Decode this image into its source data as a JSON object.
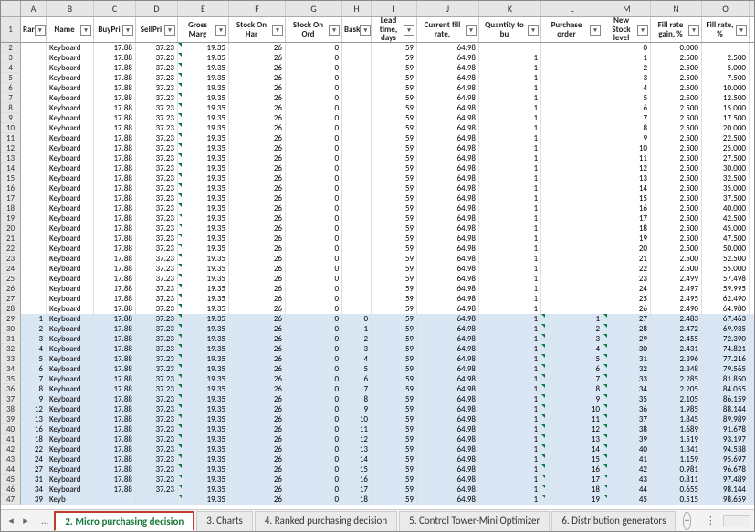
{
  "cols": [
    "A",
    "B",
    "C",
    "D",
    "E",
    "F",
    "G",
    "H",
    "I",
    "J",
    "K",
    "L",
    "M",
    "N",
    "O"
  ],
  "headers": [
    "Rar",
    "Name",
    "BuyPri",
    "SellPri",
    "Gross Marg",
    "Stock On Har",
    "Stock On Ord",
    "Bask",
    "Lead time, days",
    "Current fill rate,",
    "Quantity to bu",
    "Purchase order",
    "New Stock level",
    "Fill rate gain, %",
    "Fill rate, %"
  ],
  "widths": [
    "c-A",
    "c-B",
    "c-C",
    "c-D",
    "c-E",
    "c-F",
    "c-G",
    "c-H",
    "c-I",
    "c-J",
    "c-K",
    "c-L",
    "c-M",
    "c-N",
    "c-O"
  ],
  "align": [
    "ar",
    "al",
    "ar",
    "ar",
    "ar",
    "ar",
    "ar",
    "ar",
    "ar",
    "ar",
    "ar",
    "ar",
    "ar",
    "ar",
    "ar"
  ],
  "rows_top": [
    {
      "r": 2,
      "d": [
        "",
        "Keyboard",
        "17.88",
        "37.23",
        "19.35",
        "26",
        "0",
        "",
        "59",
        "64.98",
        "",
        "",
        "0",
        "0.000",
        ""
      ]
    },
    {
      "r": 3,
      "d": [
        "",
        "Keyboard",
        "17.88",
        "37.23",
        "19.35",
        "26",
        "0",
        "",
        "59",
        "64.98",
        "1",
        "",
        "1",
        "2.500",
        "2.500"
      ]
    },
    {
      "r": 4,
      "d": [
        "",
        "Keyboard",
        "17.88",
        "37.23",
        "19.35",
        "26",
        "0",
        "",
        "59",
        "64.98",
        "1",
        "",
        "2",
        "2.500",
        "5.000"
      ]
    },
    {
      "r": 5,
      "d": [
        "",
        "Keyboard",
        "17.88",
        "37.23",
        "19.35",
        "26",
        "0",
        "",
        "59",
        "64.98",
        "1",
        "",
        "3",
        "2.500",
        "7.500"
      ]
    },
    {
      "r": 6,
      "d": [
        "",
        "Keyboard",
        "17.88",
        "37.23",
        "19.35",
        "26",
        "0",
        "",
        "59",
        "64.98",
        "1",
        "",
        "4",
        "2.500",
        "10.000"
      ]
    },
    {
      "r": 7,
      "d": [
        "",
        "Keyboard",
        "17.88",
        "37.23",
        "19.35",
        "26",
        "0",
        "",
        "59",
        "64.98",
        "1",
        "",
        "5",
        "2.500",
        "12.500"
      ]
    },
    {
      "r": 8,
      "d": [
        "",
        "Keyboard",
        "17.88",
        "37.23",
        "19.35",
        "26",
        "0",
        "",
        "59",
        "64.98",
        "1",
        "",
        "6",
        "2.500",
        "15.000"
      ]
    },
    {
      "r": 9,
      "d": [
        "",
        "Keyboard",
        "17.88",
        "37.23",
        "19.35",
        "26",
        "0",
        "",
        "59",
        "64.98",
        "1",
        "",
        "7",
        "2.500",
        "17.500"
      ]
    },
    {
      "r": 10,
      "d": [
        "",
        "Keyboard",
        "17.88",
        "37.23",
        "19.35",
        "26",
        "0",
        "",
        "59",
        "64.98",
        "1",
        "",
        "8",
        "2.500",
        "20.000"
      ]
    },
    {
      "r": 11,
      "d": [
        "",
        "Keyboard",
        "17.88",
        "37.23",
        "19.35",
        "26",
        "0",
        "",
        "59",
        "64.98",
        "1",
        "",
        "9",
        "2.500",
        "22.500"
      ]
    },
    {
      "r": 12,
      "d": [
        "",
        "Keyboard",
        "17.88",
        "37.23",
        "19.35",
        "26",
        "0",
        "",
        "59",
        "64.98",
        "1",
        "",
        "10",
        "2.500",
        "25.000"
      ]
    },
    {
      "r": 13,
      "d": [
        "",
        "Keyboard",
        "17.88",
        "37.23",
        "19.35",
        "26",
        "0",
        "",
        "59",
        "64.98",
        "1",
        "",
        "11",
        "2.500",
        "27.500"
      ]
    },
    {
      "r": 14,
      "d": [
        "",
        "Keyboard",
        "17.88",
        "37.23",
        "19.35",
        "26",
        "0",
        "",
        "59",
        "64.98",
        "1",
        "",
        "12",
        "2.500",
        "30.000"
      ]
    },
    {
      "r": 15,
      "d": [
        "",
        "Keyboard",
        "17.88",
        "37.23",
        "19.35",
        "26",
        "0",
        "",
        "59",
        "64.98",
        "1",
        "",
        "13",
        "2.500",
        "32.500"
      ]
    },
    {
      "r": 16,
      "d": [
        "",
        "Keyboard",
        "17.88",
        "37.23",
        "19.35",
        "26",
        "0",
        "",
        "59",
        "64.98",
        "1",
        "",
        "14",
        "2.500",
        "35.000"
      ]
    },
    {
      "r": 17,
      "d": [
        "",
        "Keyboard",
        "17.88",
        "37.23",
        "19.35",
        "26",
        "0",
        "",
        "59",
        "64.98",
        "1",
        "",
        "15",
        "2.500",
        "37.500"
      ]
    },
    {
      "r": 18,
      "d": [
        "",
        "Keyboard",
        "17.88",
        "37.23",
        "19.35",
        "26",
        "0",
        "",
        "59",
        "64.98",
        "1",
        "",
        "16",
        "2.500",
        "40.000"
      ]
    },
    {
      "r": 19,
      "d": [
        "",
        "Keyboard",
        "17.88",
        "37.23",
        "19.35",
        "26",
        "0",
        "",
        "59",
        "64.98",
        "1",
        "",
        "17",
        "2.500",
        "42.500"
      ]
    },
    {
      "r": 20,
      "d": [
        "",
        "Keyboard",
        "17.88",
        "37.23",
        "19.35",
        "26",
        "0",
        "",
        "59",
        "64.98",
        "1",
        "",
        "18",
        "2.500",
        "45.000"
      ]
    },
    {
      "r": 21,
      "d": [
        "",
        "Keyboard",
        "17.88",
        "37.23",
        "19.35",
        "26",
        "0",
        "",
        "59",
        "64.98",
        "1",
        "",
        "19",
        "2.500",
        "47.500"
      ]
    },
    {
      "r": 22,
      "d": [
        "",
        "Keyboard",
        "17.88",
        "37.23",
        "19.35",
        "26",
        "0",
        "",
        "59",
        "64.98",
        "1",
        "",
        "20",
        "2.500",
        "50.000"
      ]
    },
    {
      "r": 23,
      "d": [
        "",
        "Keyboard",
        "17.88",
        "37.23",
        "19.35",
        "26",
        "0",
        "",
        "59",
        "64.98",
        "1",
        "",
        "21",
        "2.500",
        "52.500"
      ]
    },
    {
      "r": 24,
      "d": [
        "",
        "Keyboard",
        "17.88",
        "37.23",
        "19.35",
        "26",
        "0",
        "",
        "59",
        "64.98",
        "1",
        "",
        "22",
        "2.500",
        "55.000"
      ]
    },
    {
      "r": 25,
      "d": [
        "",
        "Keyboard",
        "17.88",
        "37.23",
        "19.35",
        "26",
        "0",
        "",
        "59",
        "64.98",
        "1",
        "",
        "23",
        "2.499",
        "57.498"
      ]
    },
    {
      "r": 26,
      "d": [
        "",
        "Keyboard",
        "17.88",
        "37.23",
        "19.35",
        "26",
        "0",
        "",
        "59",
        "64.98",
        "1",
        "",
        "24",
        "2.497",
        "59.995"
      ]
    },
    {
      "r": 27,
      "d": [
        "",
        "Keyboard",
        "17.88",
        "37.23",
        "19.35",
        "26",
        "0",
        "",
        "59",
        "64.98",
        "1",
        "",
        "25",
        "2.495",
        "62.490"
      ]
    },
    {
      "r": 28,
      "d": [
        "",
        "Keyboard",
        "17.88",
        "37.23",
        "19.35",
        "26",
        "0",
        "",
        "59",
        "64.98",
        "1",
        "",
        "26",
        "2.490",
        "64.980"
      ]
    }
  ],
  "rows_bot": [
    {
      "r": 29,
      "d": [
        "1",
        "Keyboard",
        "17.88",
        "37.23",
        "19.35",
        "26",
        "0",
        "0",
        "59",
        "64.98",
        "1",
        "1",
        "27",
        "2.483",
        "67.463"
      ]
    },
    {
      "r": 30,
      "d": [
        "2",
        "Keyboard",
        "17.88",
        "37.23",
        "19.35",
        "26",
        "0",
        "1",
        "59",
        "64.98",
        "1",
        "2",
        "28",
        "2.472",
        "69.935"
      ]
    },
    {
      "r": 31,
      "d": [
        "3",
        "Keyboard",
        "17.88",
        "37.23",
        "19.35",
        "26",
        "0",
        "2",
        "59",
        "64.98",
        "1",
        "3",
        "29",
        "2.455",
        "72.390"
      ]
    },
    {
      "r": 32,
      "d": [
        "4",
        "Keyboard",
        "17.88",
        "37.23",
        "19.35",
        "26",
        "0",
        "3",
        "59",
        "64.98",
        "1",
        "4",
        "30",
        "2.431",
        "74.821"
      ]
    },
    {
      "r": 33,
      "d": [
        "5",
        "Keyboard",
        "17.88",
        "37.23",
        "19.35",
        "26",
        "0",
        "4",
        "59",
        "64.98",
        "1",
        "5",
        "31",
        "2.396",
        "77.216"
      ]
    },
    {
      "r": 34,
      "d": [
        "6",
        "Keyboard",
        "17.88",
        "37.23",
        "19.35",
        "26",
        "0",
        "5",
        "59",
        "64.98",
        "1",
        "6",
        "32",
        "2.348",
        "79.565"
      ]
    },
    {
      "r": 35,
      "d": [
        "7",
        "Keyboard",
        "17.88",
        "37.23",
        "19.35",
        "26",
        "0",
        "6",
        "59",
        "64.98",
        "1",
        "7",
        "33",
        "2.285",
        "81.850"
      ]
    },
    {
      "r": 36,
      "d": [
        "8",
        "Keyboard",
        "17.88",
        "37.23",
        "19.35",
        "26",
        "0",
        "7",
        "59",
        "64.98",
        "1",
        "8",
        "34",
        "2.205",
        "84.055"
      ]
    },
    {
      "r": 37,
      "d": [
        "9",
        "Keyboard",
        "17.88",
        "37.23",
        "19.35",
        "26",
        "0",
        "8",
        "59",
        "64.98",
        "1",
        "9",
        "35",
        "2.105",
        "86.159"
      ]
    },
    {
      "r": 38,
      "d": [
        "12",
        "Keyboard",
        "17.88",
        "37.23",
        "19.35",
        "26",
        "0",
        "9",
        "59",
        "64.98",
        "1",
        "10",
        "36",
        "1.985",
        "88.144"
      ]
    },
    {
      "r": 39,
      "d": [
        "13",
        "Keyboard",
        "17.88",
        "37.23",
        "19.35",
        "26",
        "0",
        "10",
        "59",
        "64.98",
        "1",
        "11",
        "37",
        "1.845",
        "89.989"
      ]
    },
    {
      "r": 40,
      "d": [
        "16",
        "Keyboard",
        "17.88",
        "37.23",
        "19.35",
        "26",
        "0",
        "11",
        "59",
        "64.98",
        "1",
        "12",
        "38",
        "1.689",
        "91.678"
      ]
    },
    {
      "r": 41,
      "d": [
        "18",
        "Keyboard",
        "17.88",
        "37.23",
        "19.35",
        "26",
        "0",
        "12",
        "59",
        "64.98",
        "1",
        "13",
        "39",
        "1.519",
        "93.197"
      ]
    },
    {
      "r": 42,
      "d": [
        "22",
        "Keyboard",
        "17.88",
        "37.23",
        "19.35",
        "26",
        "0",
        "13",
        "59",
        "64.98",
        "1",
        "14",
        "40",
        "1.341",
        "94.538"
      ]
    },
    {
      "r": 43,
      "d": [
        "24",
        "Keyboard",
        "17.88",
        "37.23",
        "19.35",
        "26",
        "0",
        "14",
        "59",
        "64.98",
        "1",
        "15",
        "41",
        "1.159",
        "95.697"
      ]
    },
    {
      "r": 44,
      "d": [
        "27",
        "Keyboard",
        "17.88",
        "37.23",
        "19.35",
        "26",
        "0",
        "15",
        "59",
        "64.98",
        "1",
        "16",
        "42",
        "0.981",
        "96.678"
      ]
    },
    {
      "r": 45,
      "d": [
        "31",
        "Keyboard",
        "17.88",
        "37.23",
        "19.35",
        "26",
        "0",
        "16",
        "59",
        "64.98",
        "1",
        "17",
        "43",
        "0.811",
        "97.489"
      ]
    },
    {
      "r": 46,
      "d": [
        "34",
        "Keyboard",
        "17.88",
        "37.23",
        "19.35",
        "26",
        "0",
        "17",
        "59",
        "64.98",
        "1",
        "18",
        "44",
        "0.655",
        "98.144"
      ]
    },
    {
      "r": 47,
      "d": [
        "39",
        "Keyb",
        "",
        "",
        "19.35",
        "26",
        "0",
        "18",
        "59",
        "64.98",
        "1",
        "19",
        "45",
        "0.515",
        "98.659"
      ]
    }
  ],
  "tabs": {
    "dots": "...",
    "list": [
      "2. Micro purchasing decision",
      "3. Charts",
      "4. Ranked purchasing decision",
      "5. Control Tower-Mini Optimizer",
      "6. Distribution generators"
    ],
    "active": 0
  }
}
